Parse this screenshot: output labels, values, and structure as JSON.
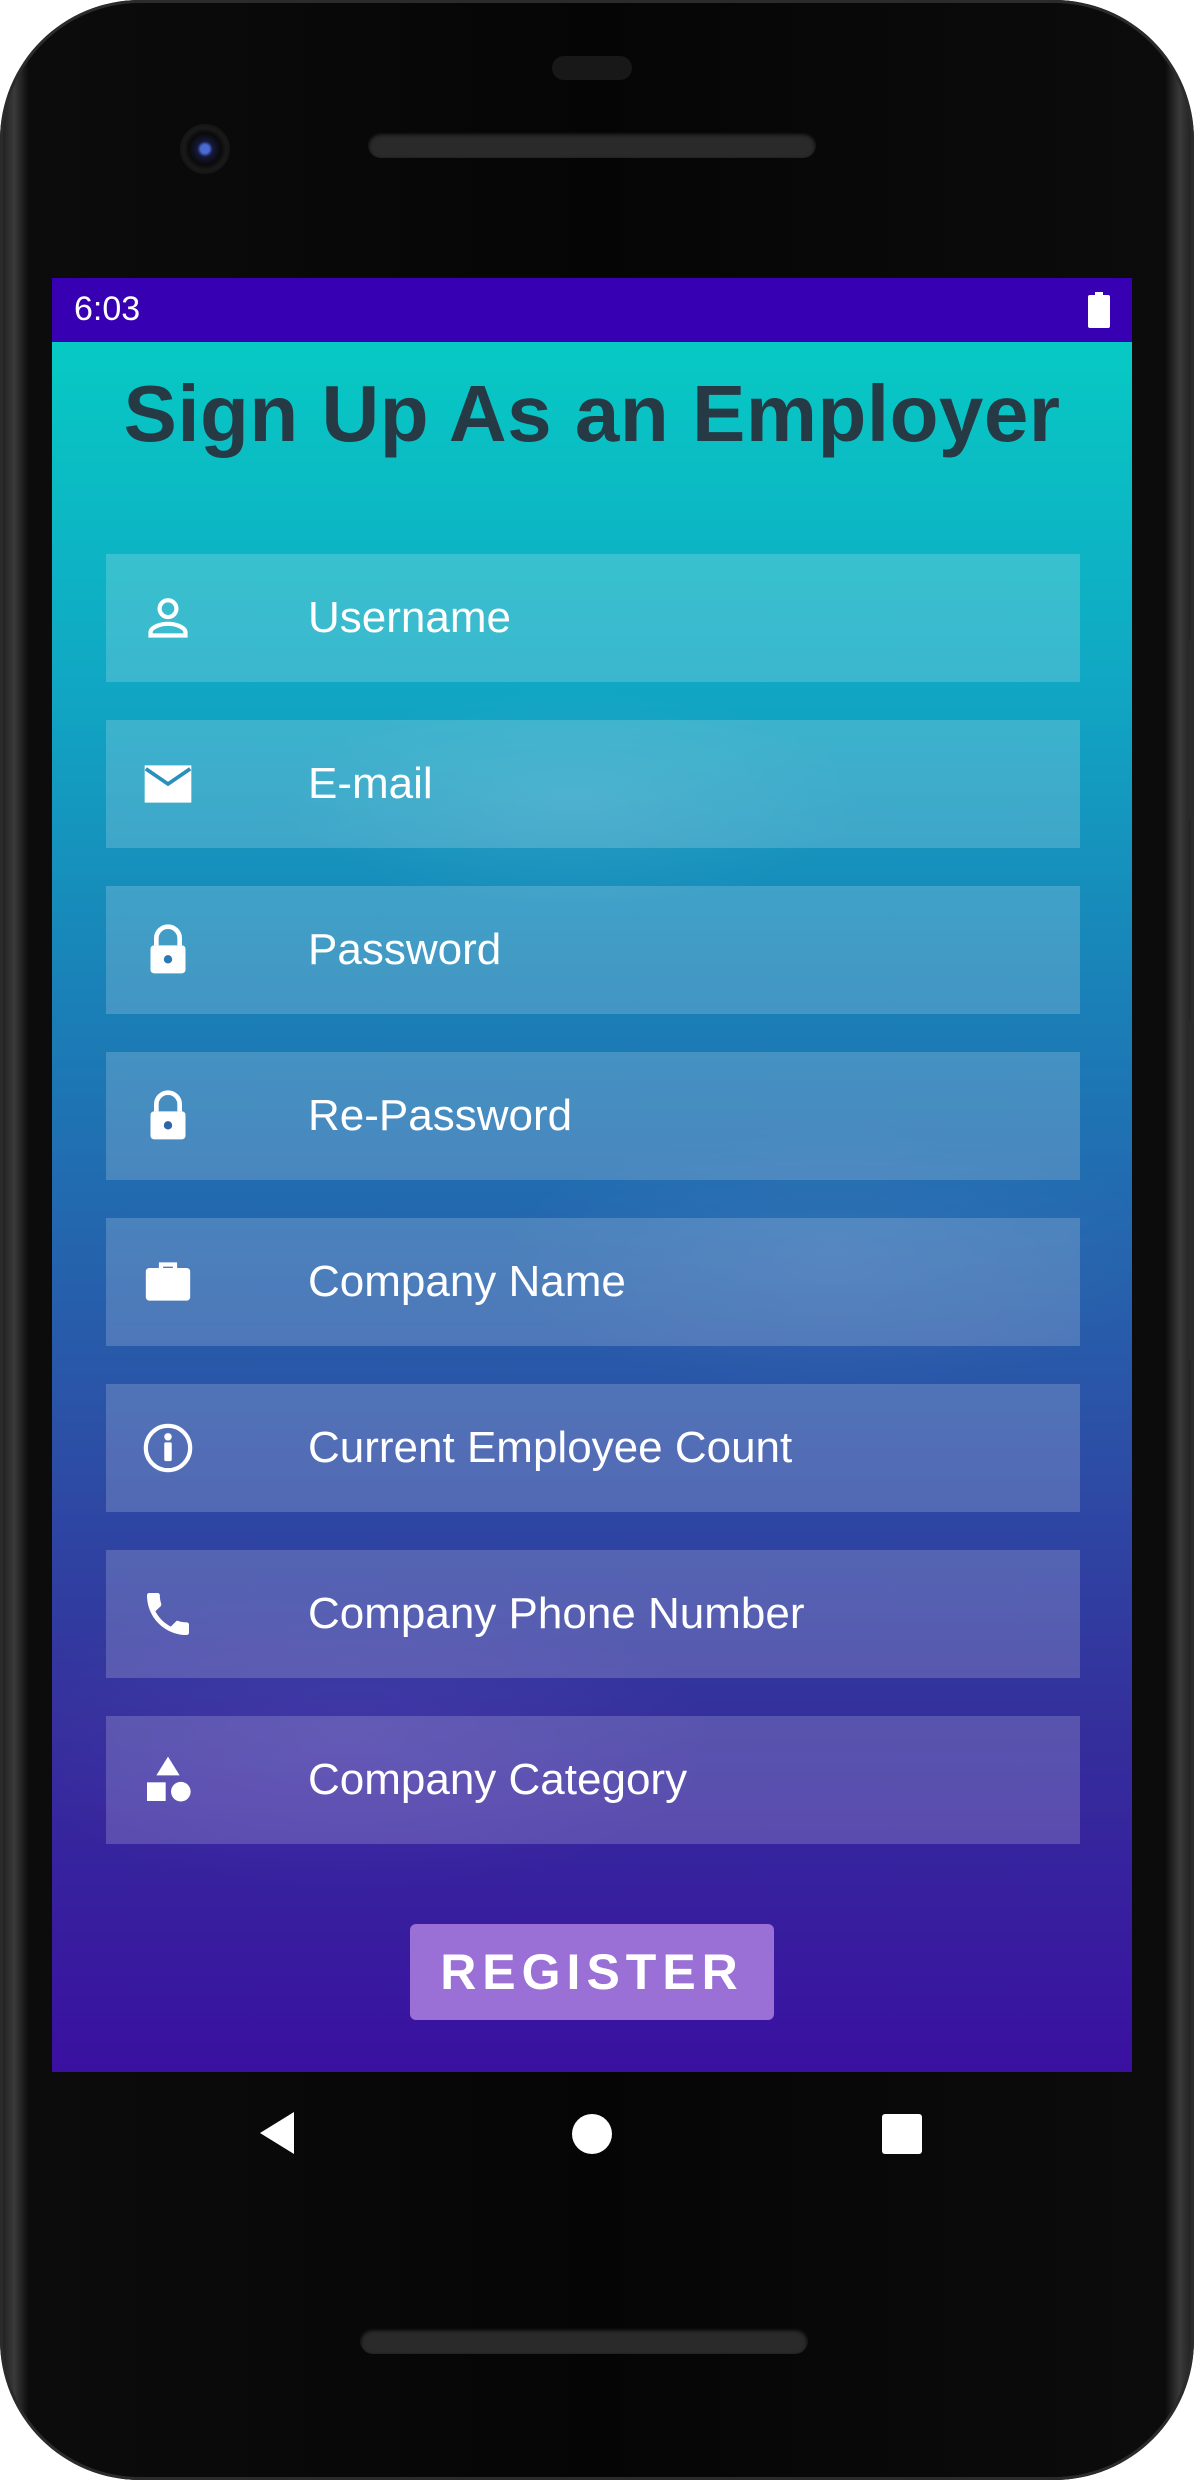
{
  "status_bar": {
    "time": "6:03"
  },
  "screen": {
    "title": "Sign Up As an Employer",
    "fields": [
      {
        "label": "Username",
        "icon": "person-icon"
      },
      {
        "label": "E-mail",
        "icon": "email-icon"
      },
      {
        "label": "Password",
        "icon": "lock-icon"
      },
      {
        "label": "Re-Password",
        "icon": "lock-icon"
      },
      {
        "label": "Company Name",
        "icon": "briefcase-icon"
      },
      {
        "label": "Current Employee Count",
        "icon": "info-person-icon"
      },
      {
        "label": "Company Phone Number",
        "icon": "phone-icon"
      },
      {
        "label": "Company Category",
        "icon": "category-shapes-icon"
      }
    ],
    "register_label": "REGISTER"
  },
  "colors": {
    "status_bar": "#3700b3",
    "title_text": "#263a45",
    "register_button": "#9a6fd6",
    "gradient_top": "#05d0c4",
    "gradient_bottom": "#3a10a0"
  }
}
